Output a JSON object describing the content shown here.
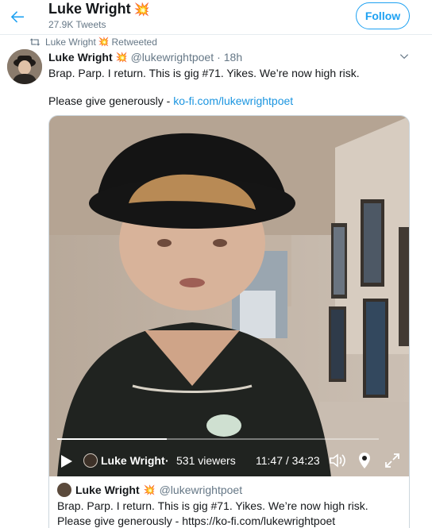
{
  "header": {
    "name": "Luke Wright",
    "emoji": "💥",
    "tweet_count": "27.9K Tweets",
    "follow_label": "Follow"
  },
  "retweet": {
    "by": "Luke Wright",
    "emoji": "💥",
    "label": "Retweeted"
  },
  "tweet": {
    "name": "Luke Wright",
    "emoji": "💥",
    "handle": "@lukewrightpoet",
    "sep": "·",
    "time": "18h",
    "text1": "Brap. Parp. I return. This is gig #71. Yikes. We’re now high risk.",
    "text2_prefix": "Please give generously - ",
    "text2_link": "ko-fi.com/lukewrightpoet"
  },
  "video": {
    "progress": 0.34,
    "host": "Luke Wright",
    "dot": "·",
    "viewers": "531 viewers",
    "time": "11:47 / 34:23"
  },
  "quote": {
    "name": "Luke Wright",
    "emoji": "💥",
    "handle": "@lukewrightpoet",
    "text": "Brap. Parp. I return. This is gig #71. Yikes. We’re now high risk. Please give generously - https://ko-fi.com/lukewrightpoet"
  },
  "colors": {
    "accent": "#1da1f2",
    "link": "#1b95e0",
    "secondary": "#657786"
  }
}
